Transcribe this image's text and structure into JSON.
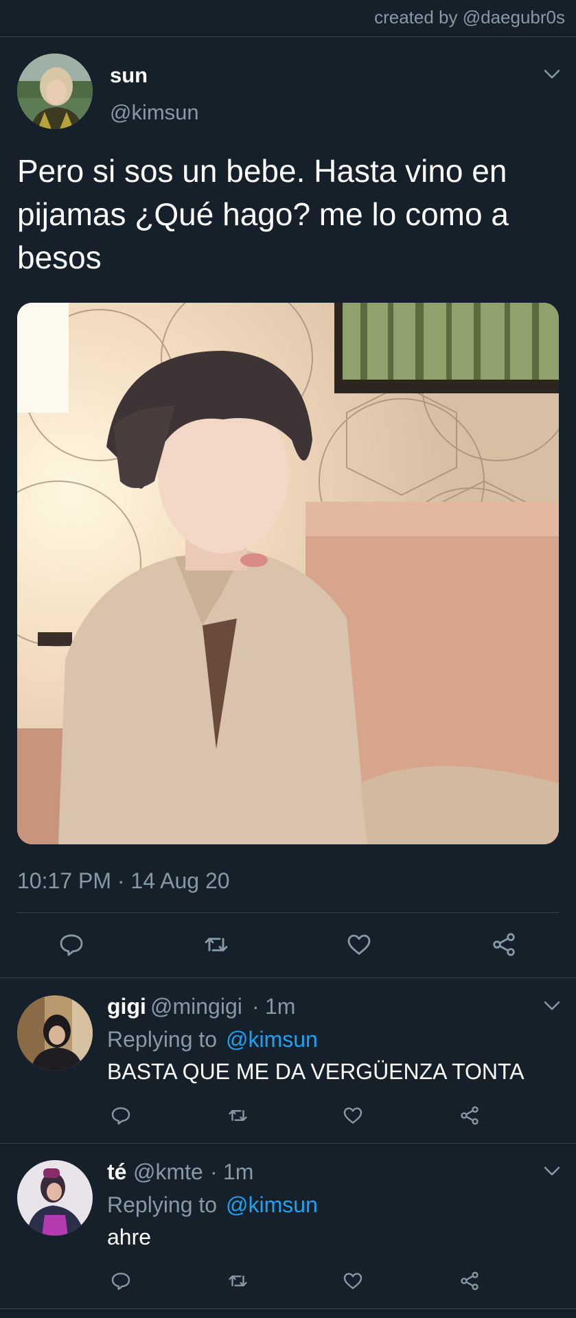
{
  "credit": "created by @daegubr0s",
  "main_tweet": {
    "name": "sun",
    "handle": "@kimsun",
    "text": "Pero si sos un bebe. Hasta vino en pijamas ¿Qué hago? me lo como a besos",
    "timestamp": "10:17 PM · 14 Aug 20"
  },
  "replies": [
    {
      "name": "gigi",
      "handle": "@mingigi",
      "dot": "·",
      "time": "1m",
      "replying_prefix": "Replying to",
      "replying_to": "@kimsun",
      "text": "BASTA QUE ME DA VERGÜENZA TONTA"
    },
    {
      "name": "té",
      "handle": "@kmte",
      "dot": "·",
      "time": "1m",
      "replying_prefix": "Replying to",
      "replying_to": "@kimsun",
      "text": "ahre"
    }
  ],
  "icons": [
    "chevron-down-icon",
    "reply-icon",
    "retweet-icon",
    "like-icon",
    "share-icon"
  ],
  "colors": {
    "background": "#15202b",
    "divider": "#38444d",
    "secondary_text": "#8899a6",
    "link": "#1da1f2",
    "primary_text": "#ffffff"
  }
}
